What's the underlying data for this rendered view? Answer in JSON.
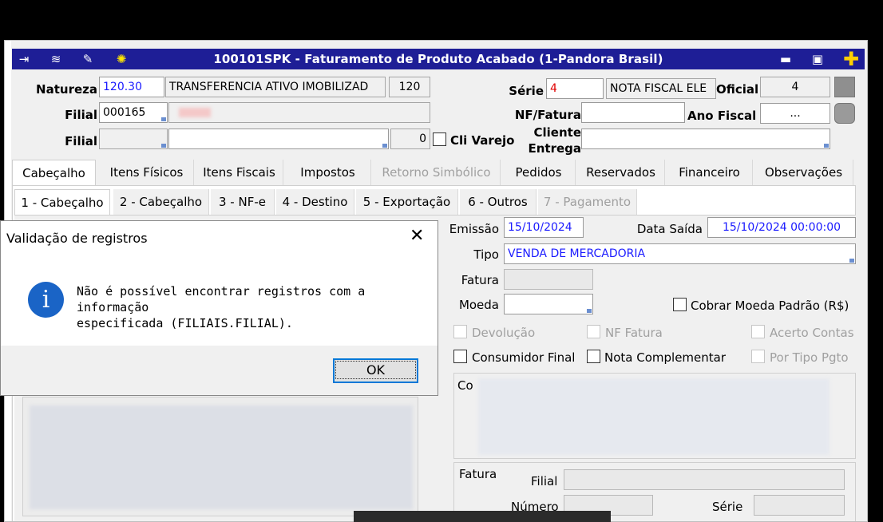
{
  "window": {
    "title": "100101SPK - Faturamento de Produto Acabado (1-Pandora Brasil)",
    "toolbar_icons": [
      "exit-icon",
      "traffic-light-icon",
      "wrench-icon",
      "lightbulb-icon"
    ],
    "controls": [
      "minimize-icon",
      "maximize-icon",
      "plus-icon"
    ]
  },
  "header": {
    "natureza_label": "Natureza",
    "natureza_code": "120.30",
    "natureza_desc": "TRANSFERENCIA ATIVO IMOBILIZAD",
    "natureza_num": "120",
    "serie_label": "Série",
    "serie_value": "4",
    "serie_desc": "NOTA FISCAL ELE",
    "oficial_label": "Oficial",
    "oficial_value": "4",
    "filial_label": "Filial",
    "filial_code": "000165",
    "nf_label": "NF/Fatura",
    "nf_value": "",
    "ano_label": "Ano Fiscal",
    "ano_value": "...",
    "filial2_label": "Filial",
    "filial2_num": "0",
    "cli_varejo": "Cli Varejo",
    "cliente_entrega_l1": "Cliente",
    "cliente_entrega_l2": "Entrega"
  },
  "tabs": [
    {
      "label": "Cabeçalho",
      "selected": true
    },
    {
      "label": "Itens Físicos"
    },
    {
      "label": "Itens Fiscais"
    },
    {
      "label": "Impostos"
    },
    {
      "label": "Retorno Simbólico",
      "disabled": true
    },
    {
      "label": "Pedidos"
    },
    {
      "label": "Reservados"
    },
    {
      "label": "Financeiro"
    },
    {
      "label": "Observações"
    }
  ],
  "subtabs": [
    {
      "label": "1 - Cabeçalho",
      "selected": true
    },
    {
      "label": "2 - Cabeçalho"
    },
    {
      "label": "3 - NF-e"
    },
    {
      "label": "4 - Destino"
    },
    {
      "label": "5 - Exportação"
    },
    {
      "label": "6 - Outros"
    },
    {
      "label": "7 - Pagamento",
      "disabled": true
    }
  ],
  "form": {
    "emissao_label": "Emissão",
    "emissao_value": "15/10/2024",
    "data_saida_label": "Data Saída",
    "data_saida_value": "15/10/2024 00:00:00",
    "tipo_label": "Tipo",
    "tipo_value": "VENDA DE MERCADORIA",
    "fatura_label": "Fatura",
    "moeda_label": "Moeda",
    "cobrar_moeda": "Cobrar Moeda Padrão (R$)",
    "devolucao": "Devolução",
    "nf_fatura": "NF Fatura",
    "acerto_contas": "Acerto Contas",
    "consumidor_final": "Consumidor Final",
    "nota_complementar": "Nota Complementar",
    "por_tipo_pgto": "Por Tipo Pgto",
    "co_group_label": "Co",
    "fatura_group_label": "Fatura",
    "fatura_filial_label": "Filial",
    "numero_label": "Número",
    "serie2_label": "Série"
  },
  "dialog": {
    "title": "Validação de registros",
    "message_line1": "Não é possível encontrar registros com a informação",
    "message_line2": "especificada (FILIAIS.FILIAL).",
    "ok_label": "OK",
    "close_glyph": "✕",
    "icon_glyph": "i"
  }
}
